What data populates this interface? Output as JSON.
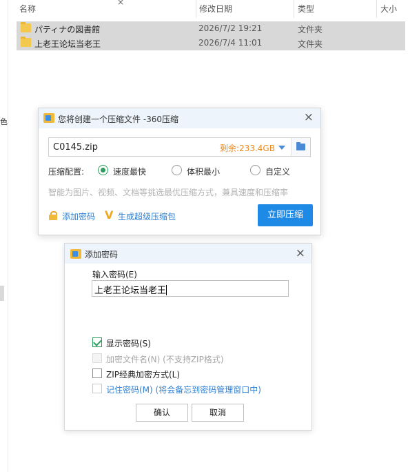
{
  "explorer": {
    "columns": {
      "name": "名称",
      "date": "修改日期",
      "type": "类型",
      "size": "大小"
    },
    "side_glyph": "色",
    "top_close": "×",
    "rows": [
      {
        "name": "パティナの図書館",
        "date": "2026/7/2 19:21",
        "type": "文件夹"
      },
      {
        "name": "上老王论坛当老王",
        "date": "2026/7/4 11:01",
        "type": "文件夹"
      }
    ]
  },
  "compress_dialog": {
    "title": "您将创建一个压缩文件 -360压缩",
    "close": "×",
    "path": "C0145.zip",
    "free_space": "剩余:233.4GB",
    "config_label": "压缩配置:",
    "options": [
      {
        "label": "速度最快",
        "selected": true
      },
      {
        "label": "体积最小",
        "selected": false
      },
      {
        "label": "自定义",
        "selected": false
      }
    ],
    "hint": "智能为图片、视频、文档等挑选最优压缩方式，兼具速度和压缩率",
    "add_password_link": "添加密码",
    "super_pack_link": "生成超级压缩包",
    "compress_button": "立即压缩"
  },
  "password_dialog": {
    "title": "添加密码",
    "close": "×",
    "input_label": "输入密码(E)",
    "password_value": "上老王论坛当老王",
    "checkboxes": [
      {
        "label": "显示密码(S)",
        "checked": true,
        "disabled": false
      },
      {
        "label": "加密文件名(N) (不支持ZIP格式)",
        "checked": false,
        "disabled": true
      },
      {
        "label": "ZIP经典加密方式(L)",
        "checked": false,
        "disabled": false
      },
      {
        "label": "记住密码(M) (将会备忘到密码管理窗口中)",
        "checked": false,
        "disabled": false
      }
    ],
    "ok_button": "确认",
    "cancel_button": "取消"
  },
  "colors": {
    "accent_blue": "#1f8ae6",
    "link_blue": "#2f7fd0",
    "free_space_orange": "#e98a1d",
    "check_green": "#2f9d5d",
    "titlebar": "#eef4fb",
    "selection_gray": "#d8d8d8"
  },
  "icons": [
    "folder-icon",
    "app-360-icon",
    "close-icon",
    "dropdown-arrow-icon",
    "browse-folder-icon",
    "lock-icon",
    "v-icon"
  ]
}
